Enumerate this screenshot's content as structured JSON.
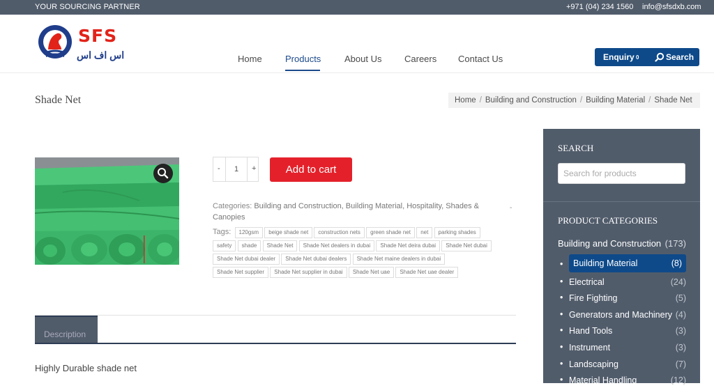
{
  "topbar": {
    "tagline": "YOUR SOURCING PARTNER",
    "phone": "+971 (04) 234 1560",
    "email": "info@sfsdxb.com"
  },
  "logo": {
    "text": "SFS",
    "arabic": "اس اف اس"
  },
  "nav": {
    "items": [
      {
        "label": "Home"
      },
      {
        "label": "Products",
        "active": true
      },
      {
        "label": "About Us"
      },
      {
        "label": "Careers"
      },
      {
        "label": "Contact Us"
      }
    ]
  },
  "header_buttons": {
    "enquiry": "Enquiry",
    "enquiry_count": "0",
    "search": "Search"
  },
  "page": {
    "title": "Shade Net",
    "breadcrumbs": [
      "Home",
      "Building and Construction",
      "Building Material",
      "Shade Net"
    ]
  },
  "product": {
    "quantity": "1",
    "minus": "-",
    "plus": "+",
    "add_to_cart": "Add to cart",
    "categories_label": "Categories:",
    "categories": "Building and Construction, Building Material, Hospitality, Shades & Canopies",
    "tags_label": "Tags:",
    "tags": [
      "120gsm",
      "beige shade net",
      "construction nets",
      "green shade net",
      "net",
      "parking shades",
      "safety",
      "shade",
      "Shade Net",
      "Shade Net dealers in dubai",
      "Shade Net deira dubai",
      "Shade Net dubai",
      "Shade Net dubai dealer",
      "Shade Net dubai dealers",
      "Shade Net maine dealers in dubai",
      "Shade Net supplier",
      "Shade Net supplier in dubai",
      "Shade Net uae",
      "Shade Net uae dealer"
    ],
    "description_tab": "Description",
    "description_text": "Highly Durable shade net"
  },
  "sidebar": {
    "search_heading": "SEARCH",
    "search_placeholder": "Search for products",
    "categories_heading": "PRODUCT CATEGORIES",
    "parent": {
      "label": "Building and Construction",
      "count": "(173)"
    },
    "items": [
      {
        "label": "Building Material",
        "count": "(8)",
        "active": true
      },
      {
        "label": "Electrical",
        "count": "(24)"
      },
      {
        "label": "Fire Fighting",
        "count": "(5)"
      },
      {
        "label": "Generators and Machinery",
        "count": "(4)"
      },
      {
        "label": "Hand Tools",
        "count": "(3)"
      },
      {
        "label": "Instrument",
        "count": "(3)"
      },
      {
        "label": "Landscaping",
        "count": "(7)"
      },
      {
        "label": "Material Handling",
        "count": "(12)"
      }
    ]
  },
  "colors": {
    "brand_blue": "#0e4a8a",
    "cart_red": "#e4212b",
    "sidebar_bg": "#515c6b"
  }
}
